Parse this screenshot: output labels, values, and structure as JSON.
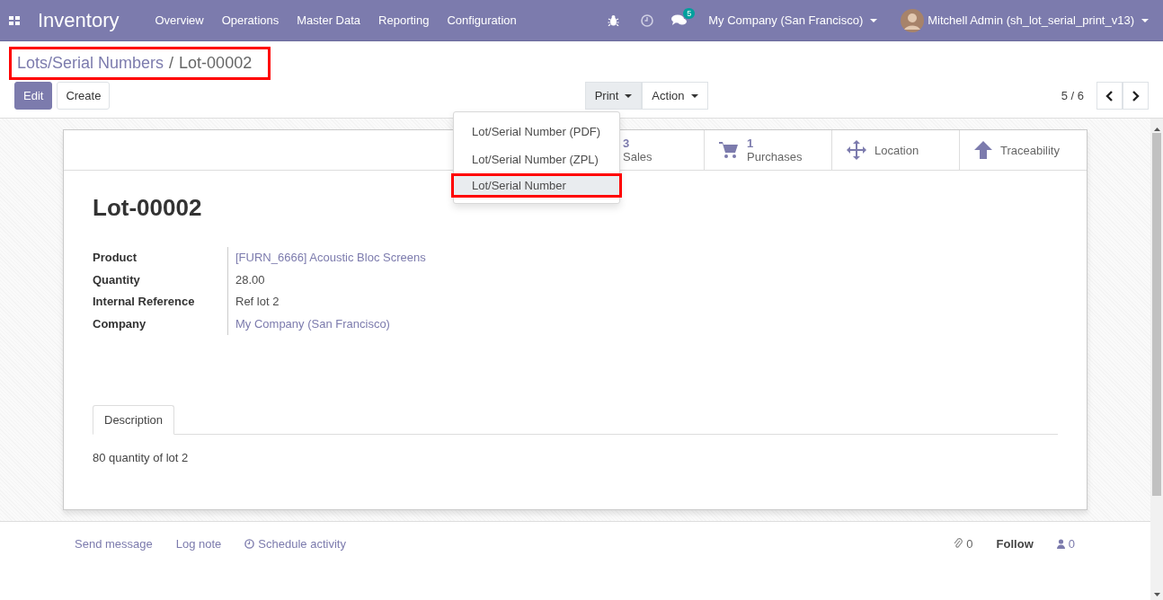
{
  "navbar": {
    "app_title": "Inventory",
    "menu": [
      "Overview",
      "Operations",
      "Master Data",
      "Reporting",
      "Configuration"
    ],
    "messages_badge": "5",
    "company": "My Company (San Francisco)",
    "user": "Mitchell Admin (sh_lot_serial_print_v13)"
  },
  "breadcrumb": {
    "parent": "Lots/Serial Numbers",
    "separator": "/",
    "current": "Lot-00002",
    "highlighted": true
  },
  "buttons": [
    {
      "label": "Edit",
      "kind": "primary"
    },
    {
      "label": "Create",
      "kind": "secondary"
    }
  ],
  "actions": [
    {
      "label": "Print",
      "selected": true
    },
    {
      "label": "Action",
      "selected": false
    }
  ],
  "pager": "5 / 6",
  "print_menu": [
    {
      "label": "Lot/Serial Number (PDF)",
      "highlighted": false
    },
    {
      "label": "Lot/Serial Number (ZPL)",
      "highlighted": false
    },
    {
      "label": "Lot/Serial Number",
      "highlighted": true
    }
  ],
  "stat_buttons": [
    {
      "kind": "sales",
      "count": "3",
      "label": "Sales"
    },
    {
      "kind": "purchases",
      "count": "1",
      "label": "Purchases"
    },
    {
      "kind": "location",
      "label": "Location"
    },
    {
      "kind": "traceability",
      "label": "Traceability"
    }
  ],
  "record": {
    "title": "Lot-00002",
    "fields": [
      {
        "label": "Product",
        "value": "[FURN_6666] Acoustic Bloc Screens",
        "kind": "link"
      },
      {
        "label": "Quantity",
        "value": "28.00",
        "kind": "text"
      },
      {
        "label": "Internal Reference",
        "value": "Ref lot 2",
        "kind": "text"
      },
      {
        "label": "Company",
        "value": "My Company (San Francisco)",
        "kind": "link"
      }
    ]
  },
  "tabs": [
    {
      "label": "Description",
      "selected": true
    }
  ],
  "description": "80 quantity of lot 2",
  "chatter": {
    "send_message": "Send message",
    "log_note": "Log note",
    "schedule_activity": "Schedule activity",
    "attachments": "0",
    "follow": "Follow",
    "followers": "0"
  }
}
